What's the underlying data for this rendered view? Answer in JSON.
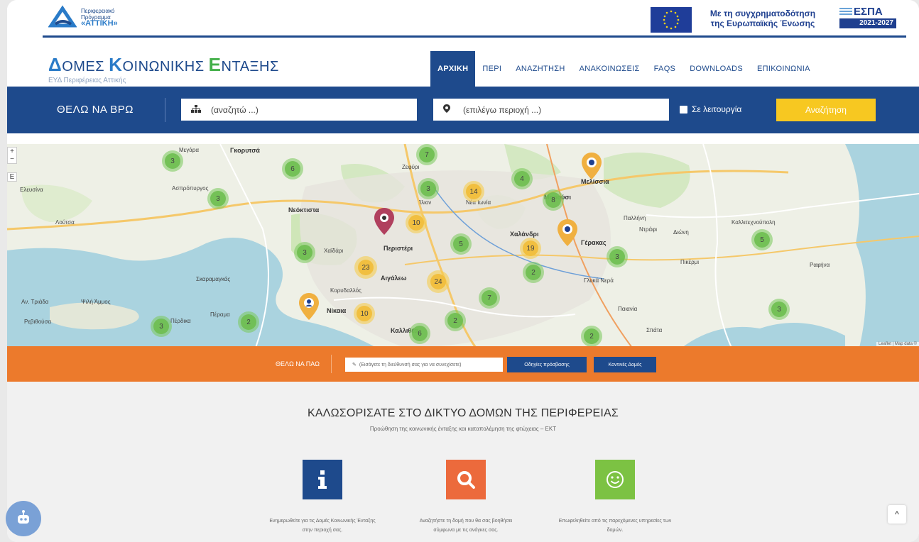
{
  "header": {
    "program_logo": [
      "Περιφερειακό",
      "Πρόγραμμα",
      "«ΑΤΤΙΚΗ»"
    ],
    "funding_text": [
      "Με τη συγχρηματοδότηση",
      "της Ευρωπαϊκής Ένωσης"
    ],
    "espa_label": "ΕΣΠΑ",
    "espa_years": "2021-2027"
  },
  "site": {
    "title_parts": [
      "Δ",
      "ΟΜΕΣ ",
      "Κ",
      "ΟΙΝΩΝΙΚΗΣ ",
      "Ε",
      "ΝΤΑΞΗΣ"
    ],
    "subtitle": "ΕΥΔ Περιφέρειας Αττικής"
  },
  "nav": {
    "items": [
      "ΑΡΧΙΚΗ",
      "ΠΕΡΙ",
      "ΑΝΑΖΗΤΗΣΗ",
      "ΑΝΑΚΟΙΝΩΣΕΙΣ",
      "FAQS",
      "DOWNLOADS",
      "ΕΠΙΚΟΙΝΩΝΙΑ"
    ],
    "active": "ΑΡΧΙΚΗ"
  },
  "search": {
    "title": "ΘΕΛΩ ΝΑ ΒΡΩ",
    "query_placeholder": "(αναζητώ ...)",
    "area_placeholder": "(επιλέγω περιοχή ...)",
    "active_label": "Σε λειτουργία",
    "button": "Αναζήτηση"
  },
  "map": {
    "zoom_in": "+",
    "zoom_out": "−",
    "layer": "E",
    "attribution": "Leaflet | Map data ©",
    "clusters": [
      {
        "count": "3",
        "color": "green"
      },
      {
        "count": "6",
        "color": "green"
      },
      {
        "count": "3",
        "color": "green"
      },
      {
        "count": "7",
        "color": "green"
      },
      {
        "count": "3",
        "color": "green"
      },
      {
        "count": "14",
        "color": "yellow"
      },
      {
        "count": "4",
        "color": "green"
      },
      {
        "count": "8",
        "color": "green"
      },
      {
        "count": "10",
        "color": "yellow"
      },
      {
        "count": "5",
        "color": "green"
      },
      {
        "count": "19",
        "color": "yellow"
      },
      {
        "count": "3",
        "color": "green"
      },
      {
        "count": "3",
        "color": "green"
      },
      {
        "count": "23",
        "color": "yellow"
      },
      {
        "count": "24",
        "color": "yellow"
      },
      {
        "count": "2",
        "color": "green"
      },
      {
        "count": "7",
        "color": "green"
      },
      {
        "count": "10",
        "color": "yellow"
      },
      {
        "count": "2",
        "color": "green"
      },
      {
        "count": "3",
        "color": "green"
      },
      {
        "count": "2",
        "color": "green"
      },
      {
        "count": "6",
        "color": "green"
      },
      {
        "count": "2",
        "color": "green"
      },
      {
        "count": "3",
        "color": "green"
      },
      {
        "count": "5",
        "color": "green"
      }
    ],
    "places": [
      "Γκορυτσά",
      "Ζεφύρι",
      "Μελίσσια",
      "Μαρούσι",
      "Νέα Ιωνία",
      "Ίλιον",
      "Νεόκτιστα",
      "Περιστέρι",
      "Χαλάνδρι",
      "Γέρακας",
      "Αιγάλεω",
      "Χαϊδάρι",
      "Κορυδαλλός",
      "Νίκαια",
      "Καλλιθέα",
      "Παλλήνη",
      "Γλυκά Νερά",
      "Παιανία",
      "Σπάτα",
      "Καλλιτεχνούπολη",
      "Ντράφι",
      "Διώνη",
      "Πικέρμι",
      "Ραφήνα",
      "Μεγάρα",
      "Ασπρόπυργος",
      "Σκαραμαγκάς",
      "Πέραμα",
      "Ελευσίνα",
      "Λούτσα",
      "Αν. Τριάδα",
      "Ρεβιθούσα",
      "Ψιλή Άμμος",
      "Πέρδικα"
    ]
  },
  "directions": {
    "title": "ΘΕΛΩ ΝΑ ΠΑΩ",
    "placeholder": "(Εισάγετε τη διεύθυνσή σας για να συνεχίσετε)",
    "btn_directions": "Οδηγίες πρόσβασης",
    "btn_nearby": "Κοντινές Δομές"
  },
  "welcome": {
    "title": "ΚΑΛΩΣΟΡΙΣΑΤΕ ΣΤΟ ΔΙΚΤΥΟ ΔΟΜΩΝ ΤΗΣ ΠΕΡΙΦΕΡΕΙΑΣ",
    "subtitle": "Προώθηση της κοινωνικής ένταξης και καταπολέμηση της φτώχειας – ΕΚΤ",
    "features": [
      {
        "icon": "info-icon",
        "color": "#1e4a8c",
        "text": "Ενημερωθείτε για τις Δομές Κοινωνικής Ένταξης στην περιοχή σας."
      },
      {
        "icon": "search-icon",
        "color": "#ec6a3c",
        "text": "Αναζητήστε τη δομή που θα σας βοηθήσει σύμφωνα με τις ανάγκες σας."
      },
      {
        "icon": "smile-icon",
        "color": "#7cc243",
        "text": "Επωφεληθείτε από τις παρεχόμενες υπηρεσίες των δομών."
      }
    ]
  },
  "widgets": {
    "chatbot_icon": "robot-icon",
    "scroll_top": "^"
  }
}
